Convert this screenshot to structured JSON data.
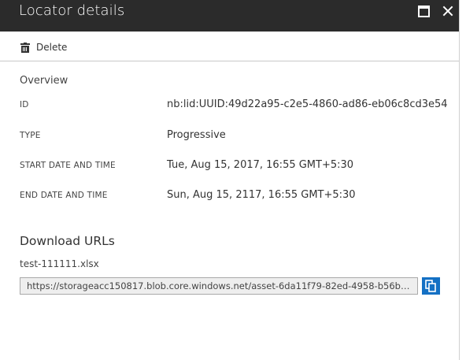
{
  "window": {
    "title": "Locator details"
  },
  "toolbar": {
    "delete_label": "Delete"
  },
  "overview": {
    "title": "Overview",
    "fields": [
      {
        "label": "ID",
        "value": "nb:lid:UUID:49d22a95-c2e5-4860-ad86-eb06c8cd3e54"
      },
      {
        "label": "TYPE",
        "value": "Progressive"
      },
      {
        "label": "START DATE AND TIME",
        "value": "Tue, Aug 15, 2017, 16:55 GMT+5:30"
      },
      {
        "label": "END DATE AND TIME",
        "value": "Sun, Aug 15, 2117, 16:55 GMT+5:30"
      }
    ]
  },
  "downloads": {
    "title": "Download URLs",
    "file_name": "test-111111.xlsx",
    "url": "https://storageacc150817.blob.core.windows.net/asset-6da11f79-82ed-4958-b56b-061894..."
  },
  "colors": {
    "titlebar": "#2b2b2b",
    "accent": "#1470c4"
  }
}
